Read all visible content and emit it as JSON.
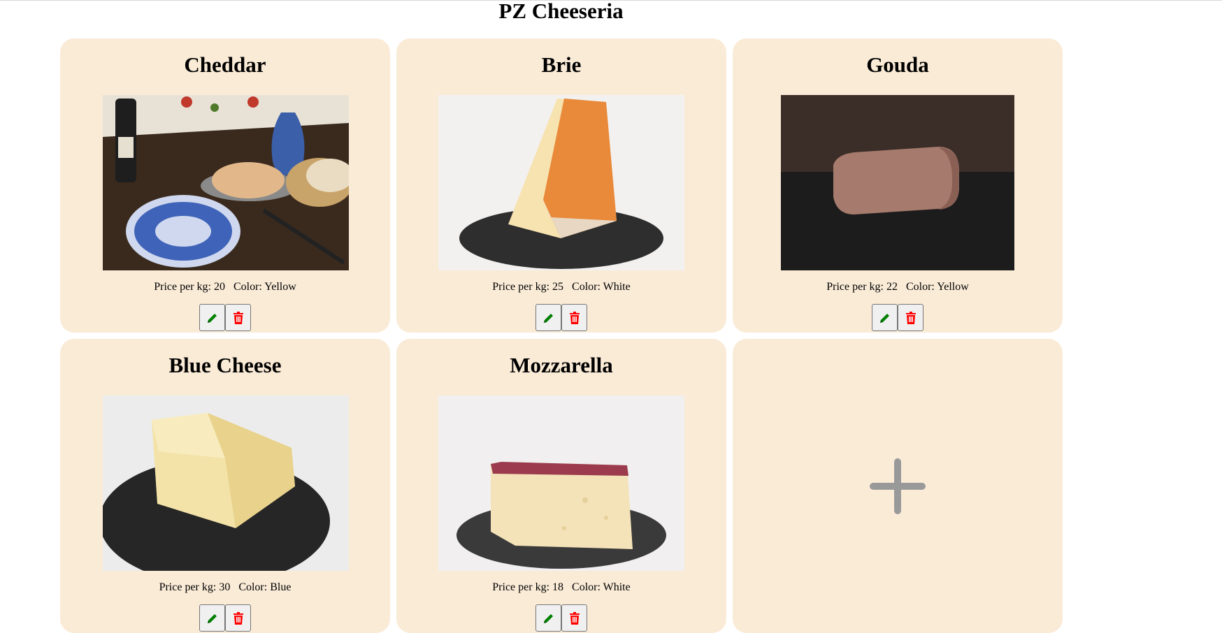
{
  "header": {
    "title": "PZ Cheeseria"
  },
  "cheeses": [
    {
      "name": "Cheddar",
      "price_label": "Price per kg:",
      "price": "20",
      "color_label": "Color:",
      "color": "Yellow"
    },
    {
      "name": "Brie",
      "price_label": "Price per kg:",
      "price": "25",
      "color_label": "Color:",
      "color": "White"
    },
    {
      "name": "Gouda",
      "price_label": "Price per kg:",
      "price": "22",
      "color_label": "Color:",
      "color": "Yellow"
    },
    {
      "name": "Blue Cheese",
      "price_label": "Price per kg:",
      "price": "30",
      "color_label": "Color:",
      "color": "Blue"
    },
    {
      "name": "Mozzarella",
      "price_label": "Price per kg:",
      "price": "18",
      "color_label": "Color:",
      "color": "White"
    }
  ],
  "icons": {
    "edit": "pencil-icon",
    "delete": "trash-icon",
    "add": "plus-icon"
  },
  "colors": {
    "card_bg": "#faebd7",
    "edit_icon": "#008000",
    "delete_icon": "#ff0000",
    "add_icon": "#999999"
  }
}
